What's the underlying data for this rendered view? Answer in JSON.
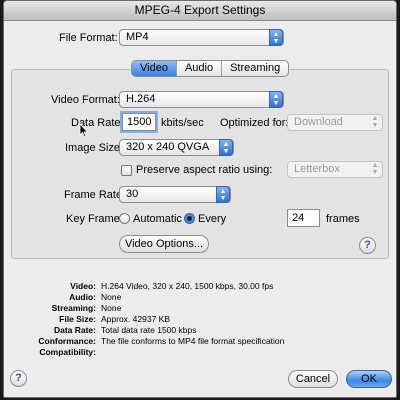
{
  "window": {
    "title": "MPEG-4 Export Settings"
  },
  "file_format": {
    "label": "File Format:",
    "value": "MP4"
  },
  "tabs": [
    {
      "label": "Video",
      "active": true
    },
    {
      "label": "Audio",
      "active": false
    },
    {
      "label": "Streaming",
      "active": false
    }
  ],
  "video": {
    "video_format": {
      "label": "Video Format:",
      "value": "H.264"
    },
    "data_rate": {
      "label": "Data Rate:",
      "value": "1500",
      "unit": "kbits/sec"
    },
    "optimized_for": {
      "label": "Optimized for:",
      "value": "Download",
      "disabled": true
    },
    "image_size": {
      "label": "Image Size:",
      "value": "320 x 240 QVGA"
    },
    "preserve_aspect": {
      "label": "Preserve aspect ratio using:",
      "checked": false
    },
    "aspect_mode": {
      "value": "Letterbox",
      "disabled": true
    },
    "frame_rate": {
      "label": "Frame Rate:",
      "value": "30"
    },
    "key_frame": {
      "label": "Key Frame:",
      "options": [
        "Automatic",
        "Every"
      ],
      "selected": "Every",
      "value": "24",
      "unit": "frames"
    },
    "options_button": "Video Options..."
  },
  "summary": [
    {
      "key": "Video:",
      "value": "H.264 Video, 320 x 240, 1500 kbps, 30.00 fps"
    },
    {
      "key": "Audio:",
      "value": "None"
    },
    {
      "key": "Streaming:",
      "value": "None"
    },
    {
      "key": "File Size:",
      "value": "Approx. 42937 KB"
    },
    {
      "key": "Data Rate:",
      "value": "Total data rate 1500 kbps"
    },
    {
      "key": "Conformance:",
      "value": "The file conforms to MP4 file format specification"
    },
    {
      "key": "Compatibility:",
      "value": ""
    }
  ],
  "buttons": {
    "cancel": "Cancel",
    "ok": "OK",
    "help": "?"
  }
}
